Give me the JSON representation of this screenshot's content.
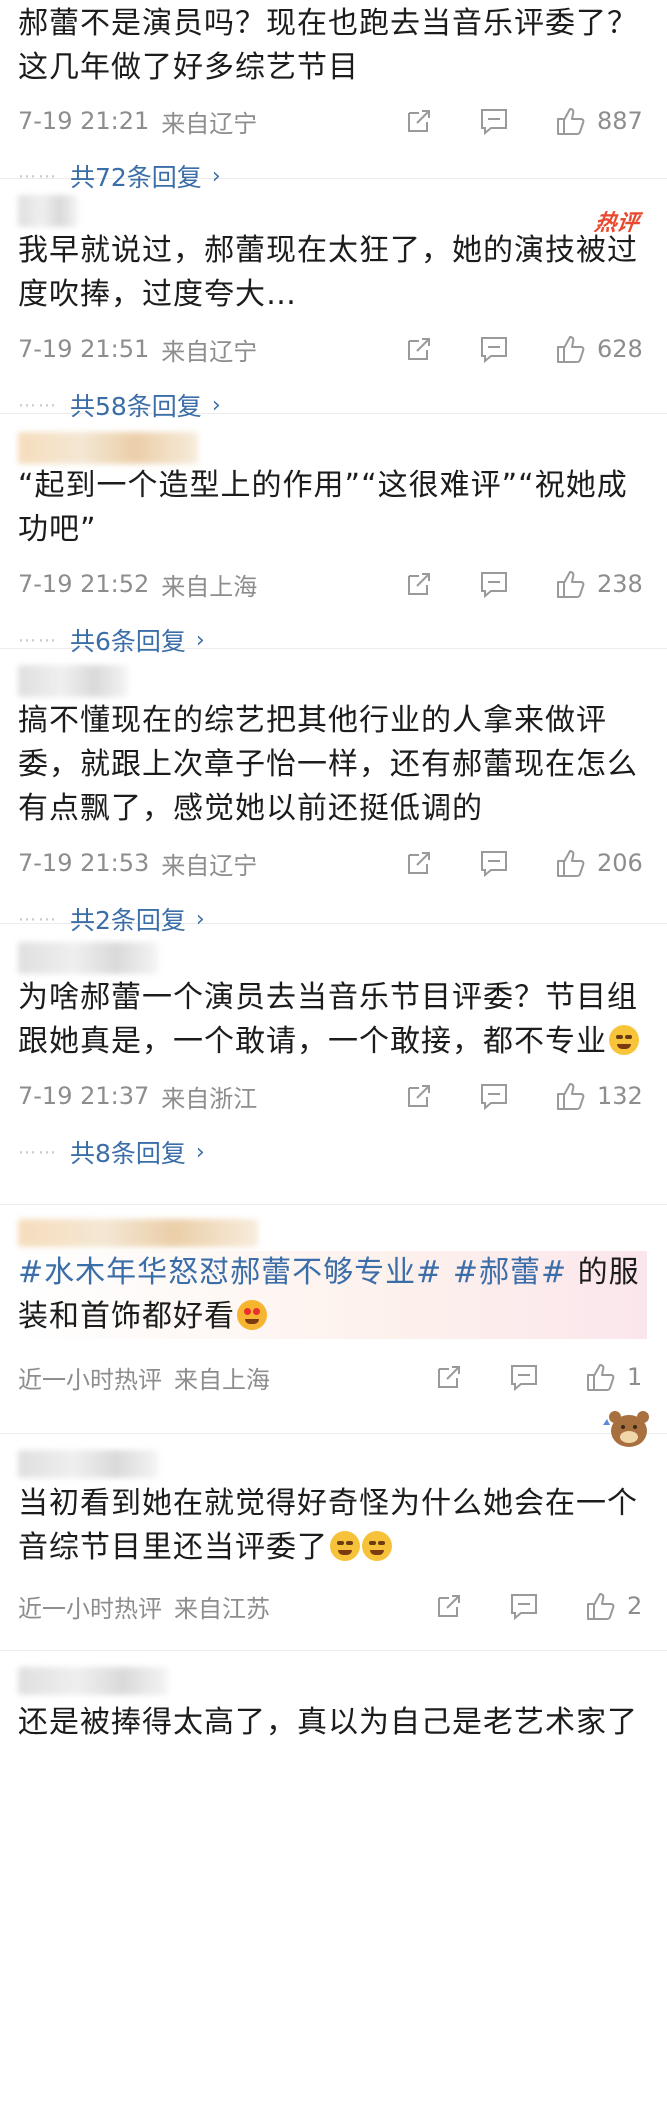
{
  "comments": [
    {
      "text": "郝蕾不是演员吗？现在也跑去当音乐评委了？这几年做了好多综艺节目",
      "time": "7-19 21:21",
      "location": "来自辽宁",
      "likes": "887",
      "replies": "共72条回复"
    },
    {
      "hot_tag": "热评",
      "text": "我早就说过，郝蕾现在太狂了，她的演技被过度吹捧，过度夸大…",
      "time": "7-19 21:51",
      "location": "来自辽宁",
      "likes": "628",
      "replies": "共58条回复"
    },
    {
      "text": "“起到一个造型上的作用”“这很难评”“祝她成功吧”",
      "time": "7-19 21:52",
      "location": "来自上海",
      "likes": "238",
      "replies": "共6条回复"
    },
    {
      "text": "搞不懂现在的综艺把其他行业的人拿来做评委，就跟上次章子怡一样，还有郝蕾现在怎么有点飘了，感觉她以前还挺低调的",
      "time": "7-19 21:53",
      "location": "来自辽宁",
      "likes": "206",
      "replies": "共2条回复"
    },
    {
      "text": "为啥郝蕾一个演员去当音乐节目评委？节目组跟她真是，一个敢请，一个敢接，都不专业",
      "time": "7-19 21:37",
      "location": "来自浙江",
      "likes": "132",
      "replies": "共8条回复"
    },
    {
      "hashtag1": "#水木年华怒怼郝蕾不够专业#",
      "hashtag2": "#郝蕾#",
      "text": " 的服装和首饰都好看",
      "time": "近一小时热评",
      "location": "来自上海",
      "likes": "1"
    },
    {
      "text": "当初看到她在就觉得好奇怪为什么她会在一个音综节目里还当评委了",
      "time": "近一小时热评",
      "location": "来自江苏",
      "likes": "2"
    },
    {
      "text": "还是被捧得太高了，真以为自己是老艺术家了"
    }
  ],
  "icons": {
    "share": "share-icon",
    "comment": "comment-icon",
    "like": "thumbs-up-icon",
    "chevron": "chevron-right-icon"
  },
  "colors": {
    "link": "#3b6ea8",
    "hot": "#e8492f",
    "meta": "#8d8d8d"
  }
}
